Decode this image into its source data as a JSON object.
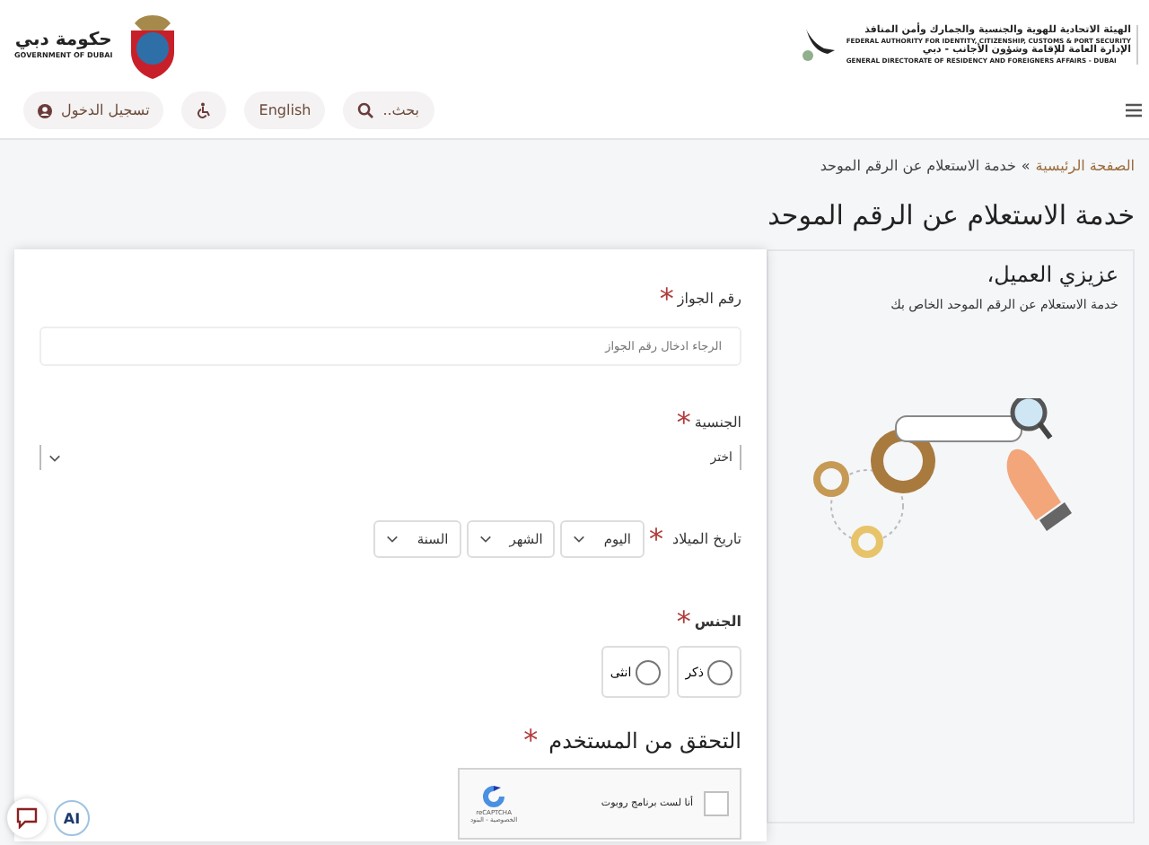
{
  "header": {
    "authority_logo": {
      "lines": [
        "الهيئة الاتحادية للهوية والجنسية والجمارك وأمن المنافذ",
        "FEDERAL AUTHORITY FOR IDENTITY, CITIZENSHIP, CUSTOMS & PORT SECURITY",
        "الإدارة العامة للإقامة وشؤون الأجانب - دبي",
        "GENERAL DIRECTORATE OF RESIDENCY AND FOREIGNERS AFFAIRS - DUBAI"
      ]
    },
    "government_logo": {
      "lines": [
        "حكومة دبي",
        "GOVERNMENT OF DUBAI"
      ]
    }
  },
  "nav": {
    "search": {
      "placeholder": "بحث.."
    },
    "language": "English",
    "login": "تسجيل الدخول"
  },
  "breadcrumb": [
    {
      "label": "الصفحة الرئيسية",
      "kind": "link"
    },
    {
      "label": "»",
      "kind": "separator"
    },
    {
      "label": "خدمة الاستعلام عن الرقم الموحد",
      "kind": "current"
    }
  ],
  "page_title": "خدمة الاستعلام عن الرقم الموحد",
  "intro": {
    "heading": "عزيزي العميل،",
    "text": "خدمة الاستعلام عن الرقم الموحد الخاص بك"
  },
  "form": {
    "passport": {
      "label": "رقم الجواز",
      "required_mark": "*",
      "placeholder": "الرجاء ادخال رقم الجواز"
    },
    "nationality": {
      "label": "الجنسية",
      "required_mark": "*",
      "value": "اختر"
    },
    "birth_date": {
      "label": "تاريخ الميلاد",
      "required_mark": "*",
      "selects": [
        "اليوم",
        "الشهر",
        "السنة"
      ]
    },
    "gender": {
      "label": "الجنس",
      "required_mark": "*",
      "options": [
        {
          "label": "ذكر",
          "selected": false
        },
        {
          "label": "انثى",
          "selected": false
        }
      ]
    },
    "captcha": {
      "heading": "التحقق من المستخدم",
      "required_mark": "*",
      "checkbox_label": "أنا لست برنامج روبوت",
      "checked": false,
      "brand": "reCAPTCHA",
      "terms": "الخصوصية - البنود"
    }
  },
  "floating": {
    "ai_badge": "AI"
  }
}
